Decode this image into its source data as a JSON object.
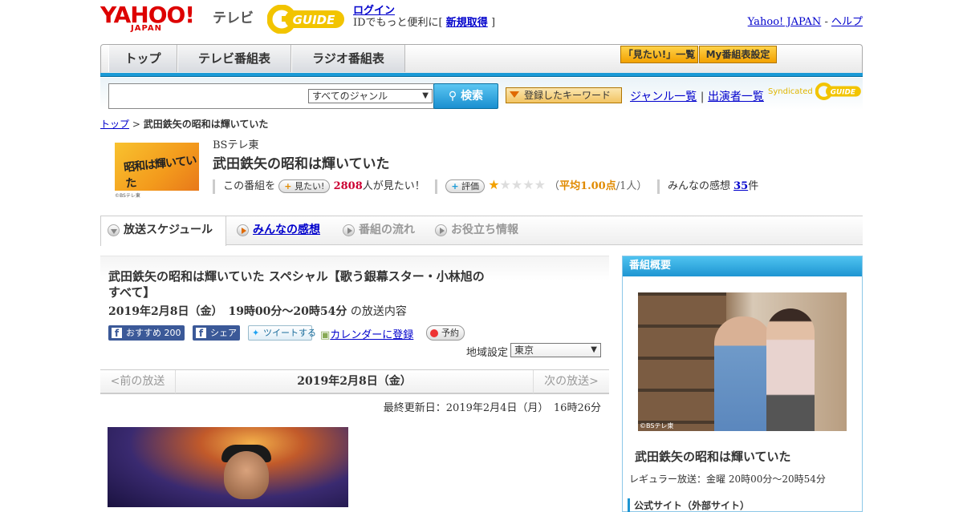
{
  "header": {
    "yahoo_logo": "YAHOO!",
    "yahoo_japan": "JAPAN",
    "tv_label": "テレビ",
    "gguide_logo": "GUIDE",
    "login": "ログイン",
    "login_desc": "IDでもっと便利に[",
    "signup": "新規取得",
    "signup_close": "]",
    "yahoo_japan_link": "Yahoo! JAPAN",
    "sep": "-",
    "help": "ヘルプ"
  },
  "nav": {
    "tabs": [
      "トップ",
      "テレビ番組表",
      "ラジオ番組表"
    ],
    "mitai_list": "「見たい!」一覧",
    "my_bangumi": "My番組表設定"
  },
  "search": {
    "genre_selected": "すべてのジャンル",
    "button": "検索",
    "keyword_button": "登録したキーワード",
    "genre_list": "ジャンル一覧",
    "divider": "|",
    "cast_list": "出演者一覧",
    "syndicated": "Syndicated"
  },
  "breadcrumb": {
    "top": "トップ",
    "sep": ">",
    "current": "武田鉄矢の昭和は輝いていた"
  },
  "program": {
    "station": "BSテレ東",
    "title": "武田鉄矢の昭和は輝いていた",
    "thumb_text": "昭和は輝いていた",
    "thumb_caption": "©BSテレ東",
    "this_program": "この番組を",
    "mitai_btn": "見たい!",
    "mitai_count": "2808",
    "mitai_suffix": "人が見たい！",
    "rate_btn": "評価",
    "rating_stars": 1,
    "avg_open": "（",
    "avg_label": "平均1.00点",
    "avg_people": "/1人）",
    "minna_label": "みんなの感想",
    "minna_count": "35",
    "minna_suffix": "件"
  },
  "tabs2": [
    "放送スケジュール",
    "みんなの感想",
    "番組の流れ",
    "お役立ち情報"
  ],
  "episode": {
    "title": "武田鉄矢の昭和は輝いていた スペシャル【歌う銀幕スター・小林旭のすべて】",
    "date": "2019年2月8日（金）　19時00分～20時54分",
    "date_suffix": "の放送内容",
    "fb_recommend": "おすすめ 200",
    "fb_share": "シェア",
    "tweet": "ツイートする",
    "calendar": "カレンダーに登録",
    "reserve": "予約",
    "region_label": "地域設定",
    "region_value": "東京",
    "prev": "<前の放送",
    "current": "2019年2月8日（金）",
    "next": "次の放送>",
    "updated": "最終更新日：2019年2月4日（月）　16時26分"
  },
  "sidebar": {
    "heading": "番組概要",
    "photo_caption": "©BSテレ東",
    "title": "武田鉄矢の昭和は輝いていた",
    "regular": "レギュラー放送：金曜 20時00分～20時54分",
    "official": "公式サイト（外部サイト）"
  },
  "colors": {
    "accent_blue": "#1a9ad6",
    "yahoo_red": "#dd0000",
    "orange": "#f2a100",
    "link": "#0000cc",
    "count_red": "#cc0033"
  }
}
